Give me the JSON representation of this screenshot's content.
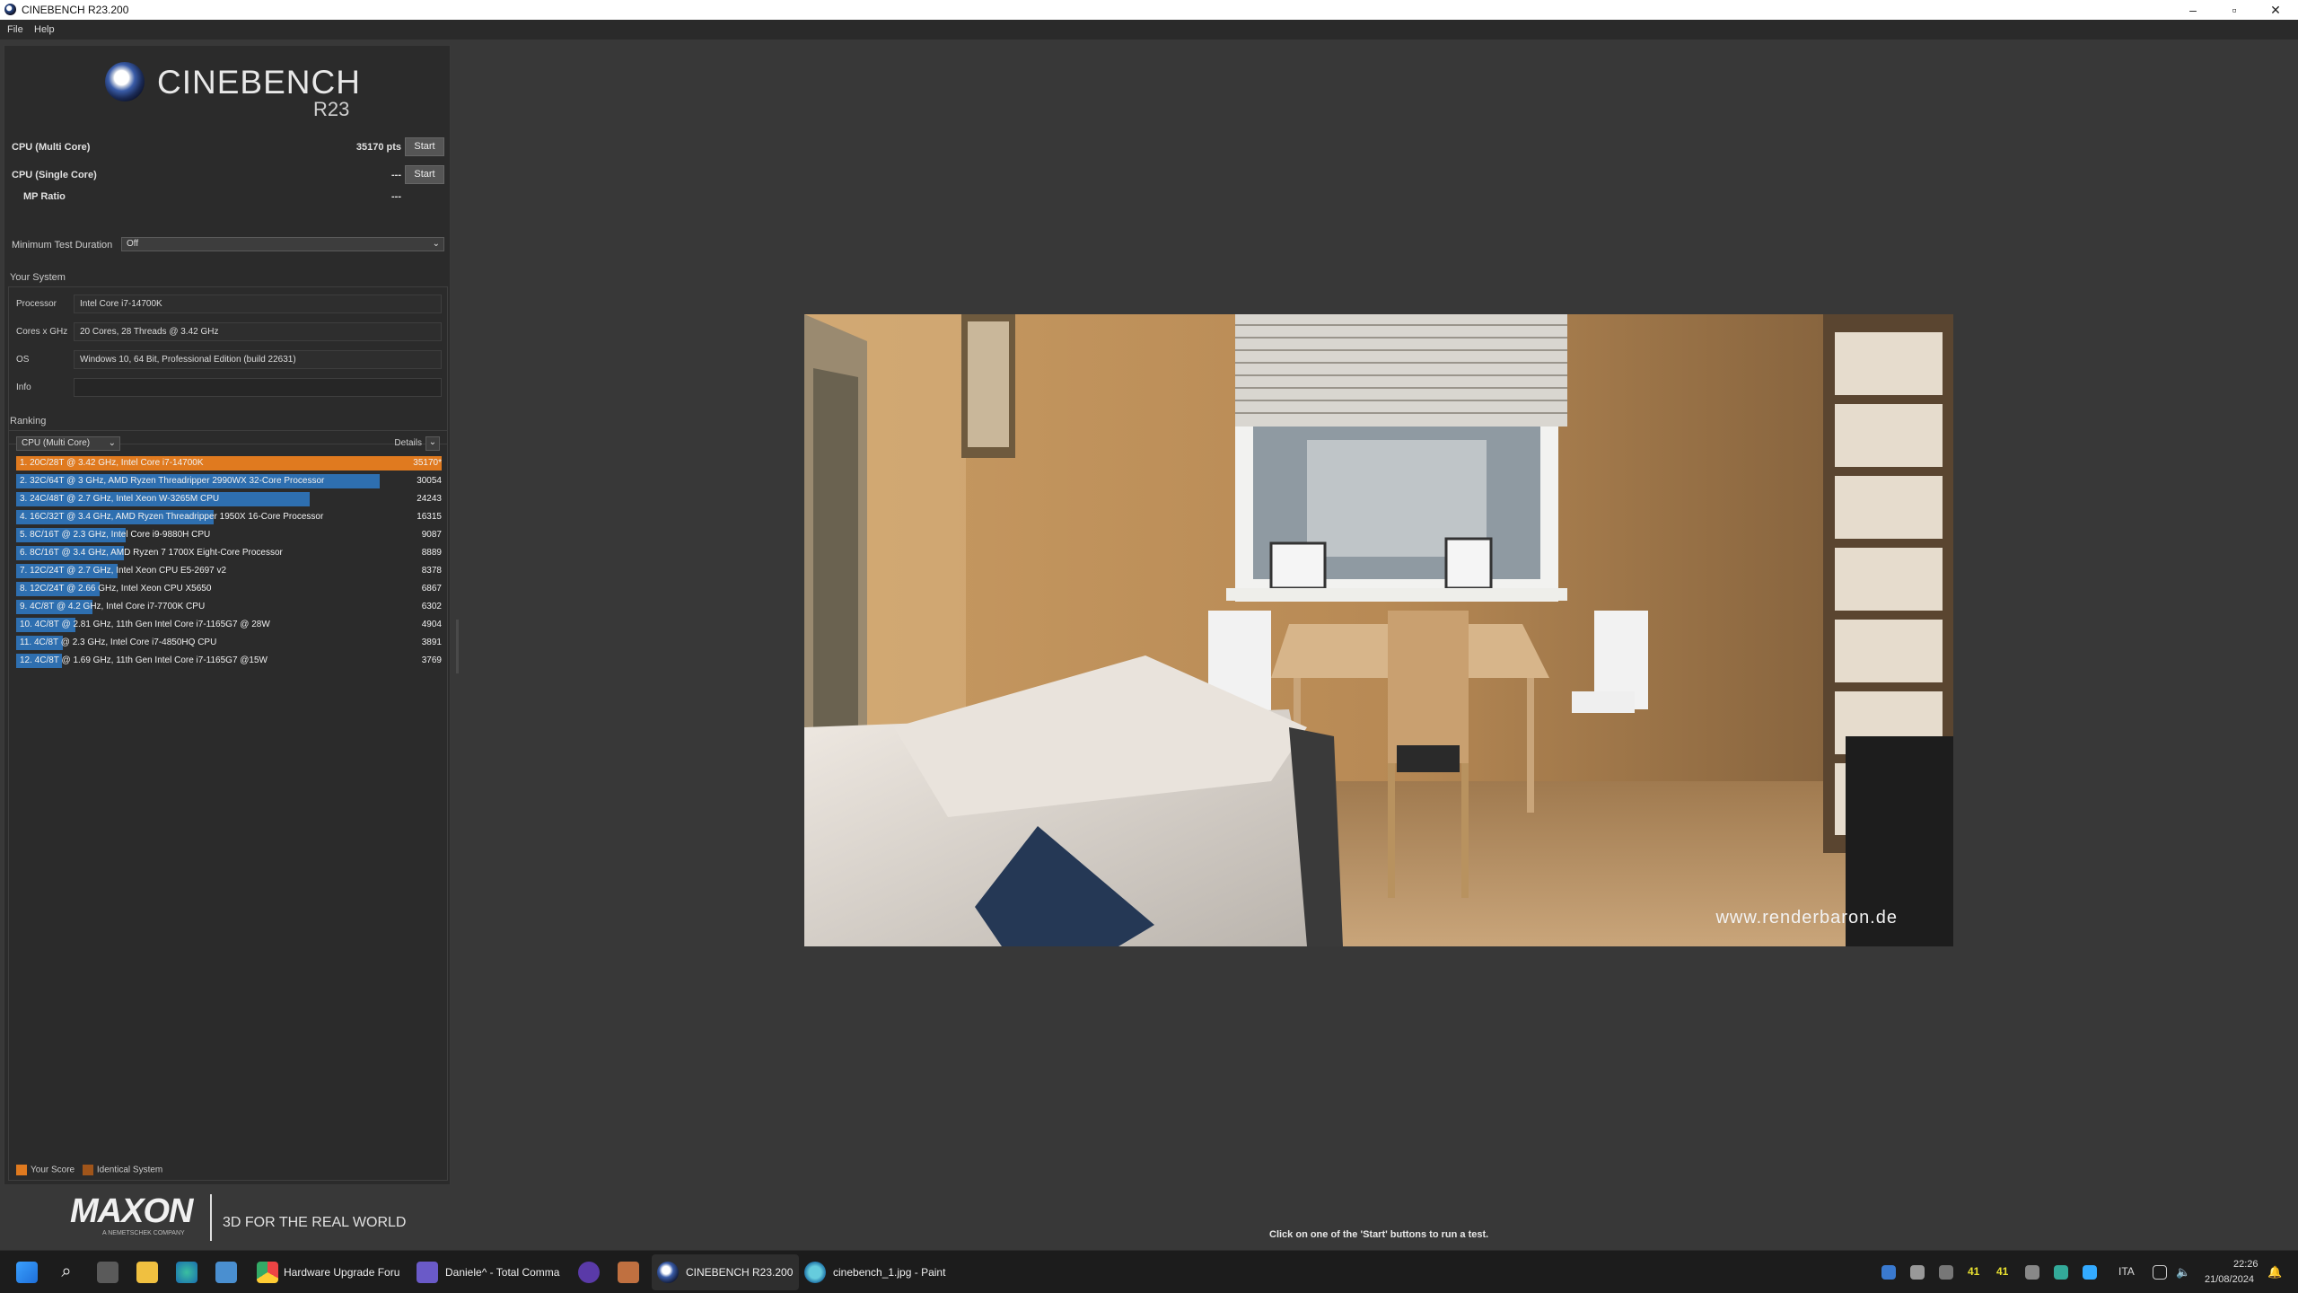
{
  "window": {
    "title": "CINEBENCH R23.200",
    "minimize": "–",
    "maximize": "▫",
    "close": "✕"
  },
  "menu": {
    "file": "File",
    "help": "Help"
  },
  "logo": {
    "name": "CINEBENCH",
    "version": "R23"
  },
  "tests": [
    {
      "label": "CPU (Multi Core)",
      "score": "35170 pts",
      "button": "Start"
    },
    {
      "label": "CPU (Single Core)",
      "score": "---",
      "button": "Start"
    },
    {
      "label": "MP Ratio",
      "score": "---"
    }
  ],
  "min_duration": {
    "label": "Minimum Test Duration",
    "value": "Off"
  },
  "your_system": {
    "heading": "Your System",
    "rows": [
      {
        "key": "Processor",
        "value": "Intel Core i7-14700K"
      },
      {
        "key": "Cores x GHz",
        "value": "20 Cores, 28 Threads @ 3.42 GHz"
      },
      {
        "key": "OS",
        "value": "Windows 10, 64 Bit, Professional Edition (build 22631)"
      },
      {
        "key": "Info",
        "value": ""
      }
    ]
  },
  "ranking": {
    "heading": "Ranking",
    "dropdown": "CPU (Multi Core)",
    "details": "Details",
    "max": 35170,
    "items": [
      {
        "text": "1. 20C/28T @ 3.42 GHz, Intel Core i7-14700K",
        "value": 35170,
        "display": "35170*",
        "highlight": true
      },
      {
        "text": "2. 32C/64T @ 3 GHz, AMD Ryzen Threadripper 2990WX 32-Core Processor",
        "value": 30054,
        "display": "30054"
      },
      {
        "text": "3. 24C/48T @ 2.7 GHz, Intel Xeon W-3265M CPU",
        "value": 24243,
        "display": "24243"
      },
      {
        "text": "4. 16C/32T @ 3.4 GHz, AMD Ryzen Threadripper 1950X 16-Core Processor",
        "value": 16315,
        "display": "16315"
      },
      {
        "text": "5. 8C/16T @ 2.3 GHz, Intel Core i9-9880H CPU",
        "value": 9087,
        "display": "9087"
      },
      {
        "text": "6. 8C/16T @ 3.4 GHz, AMD Ryzen 7 1700X Eight-Core Processor",
        "value": 8889,
        "display": "8889"
      },
      {
        "text": "7. 12C/24T @ 2.7 GHz, Intel Xeon CPU E5-2697 v2",
        "value": 8378,
        "display": "8378"
      },
      {
        "text": "8. 12C/24T @ 2.66 GHz, Intel Xeon CPU X5650",
        "value": 6867,
        "display": "6867"
      },
      {
        "text": "9. 4C/8T @ 4.2 GHz, Intel Core i7-7700K CPU",
        "value": 6302,
        "display": "6302"
      },
      {
        "text": "10. 4C/8T @ 2.81 GHz, 11th Gen Intel Core i7-1165G7 @ 28W",
        "value": 4904,
        "display": "4904"
      },
      {
        "text": "11. 4C/8T @ 2.3 GHz, Intel Core i7-4850HQ CPU",
        "value": 3891,
        "display": "3891"
      },
      {
        "text": "12. 4C/8T @ 1.69 GHz, 11th Gen Intel Core i7-1165G7 @15W",
        "value": 3769,
        "display": "3769"
      }
    ],
    "legend": {
      "your_score": "Your Score",
      "identical": "Identical System"
    }
  },
  "footer": {
    "brand": "MAXON",
    "brand_sub": "A NEMETSCHEK COMPANY",
    "tagline": "3D FOR THE REAL WORLD",
    "hint": "Click on one of the 'Start' buttons to run a test."
  },
  "render": {
    "watermark": "www.renderbaron.de"
  },
  "taskbar": {
    "apps": [
      {
        "label": "Hardware Upgrade Foru",
        "icon": "chrome-icon"
      },
      {
        "label": "Daniele^ - Total Comma",
        "icon": "total-commander-icon"
      },
      {
        "label": "CINEBENCH R23.200",
        "icon": "cinebench-icon"
      },
      {
        "label": "cinebench_1.jpg - Paint",
        "icon": "paint-icon"
      }
    ],
    "tray": {
      "temp1": "41",
      "temp2": "41",
      "lang": "ITA",
      "time": "22:26",
      "date": "21/08/2024"
    }
  },
  "colors": {
    "accent_orange": "#e07a1f",
    "bar_blue": "#2e6fb0",
    "bg": "#383838"
  }
}
